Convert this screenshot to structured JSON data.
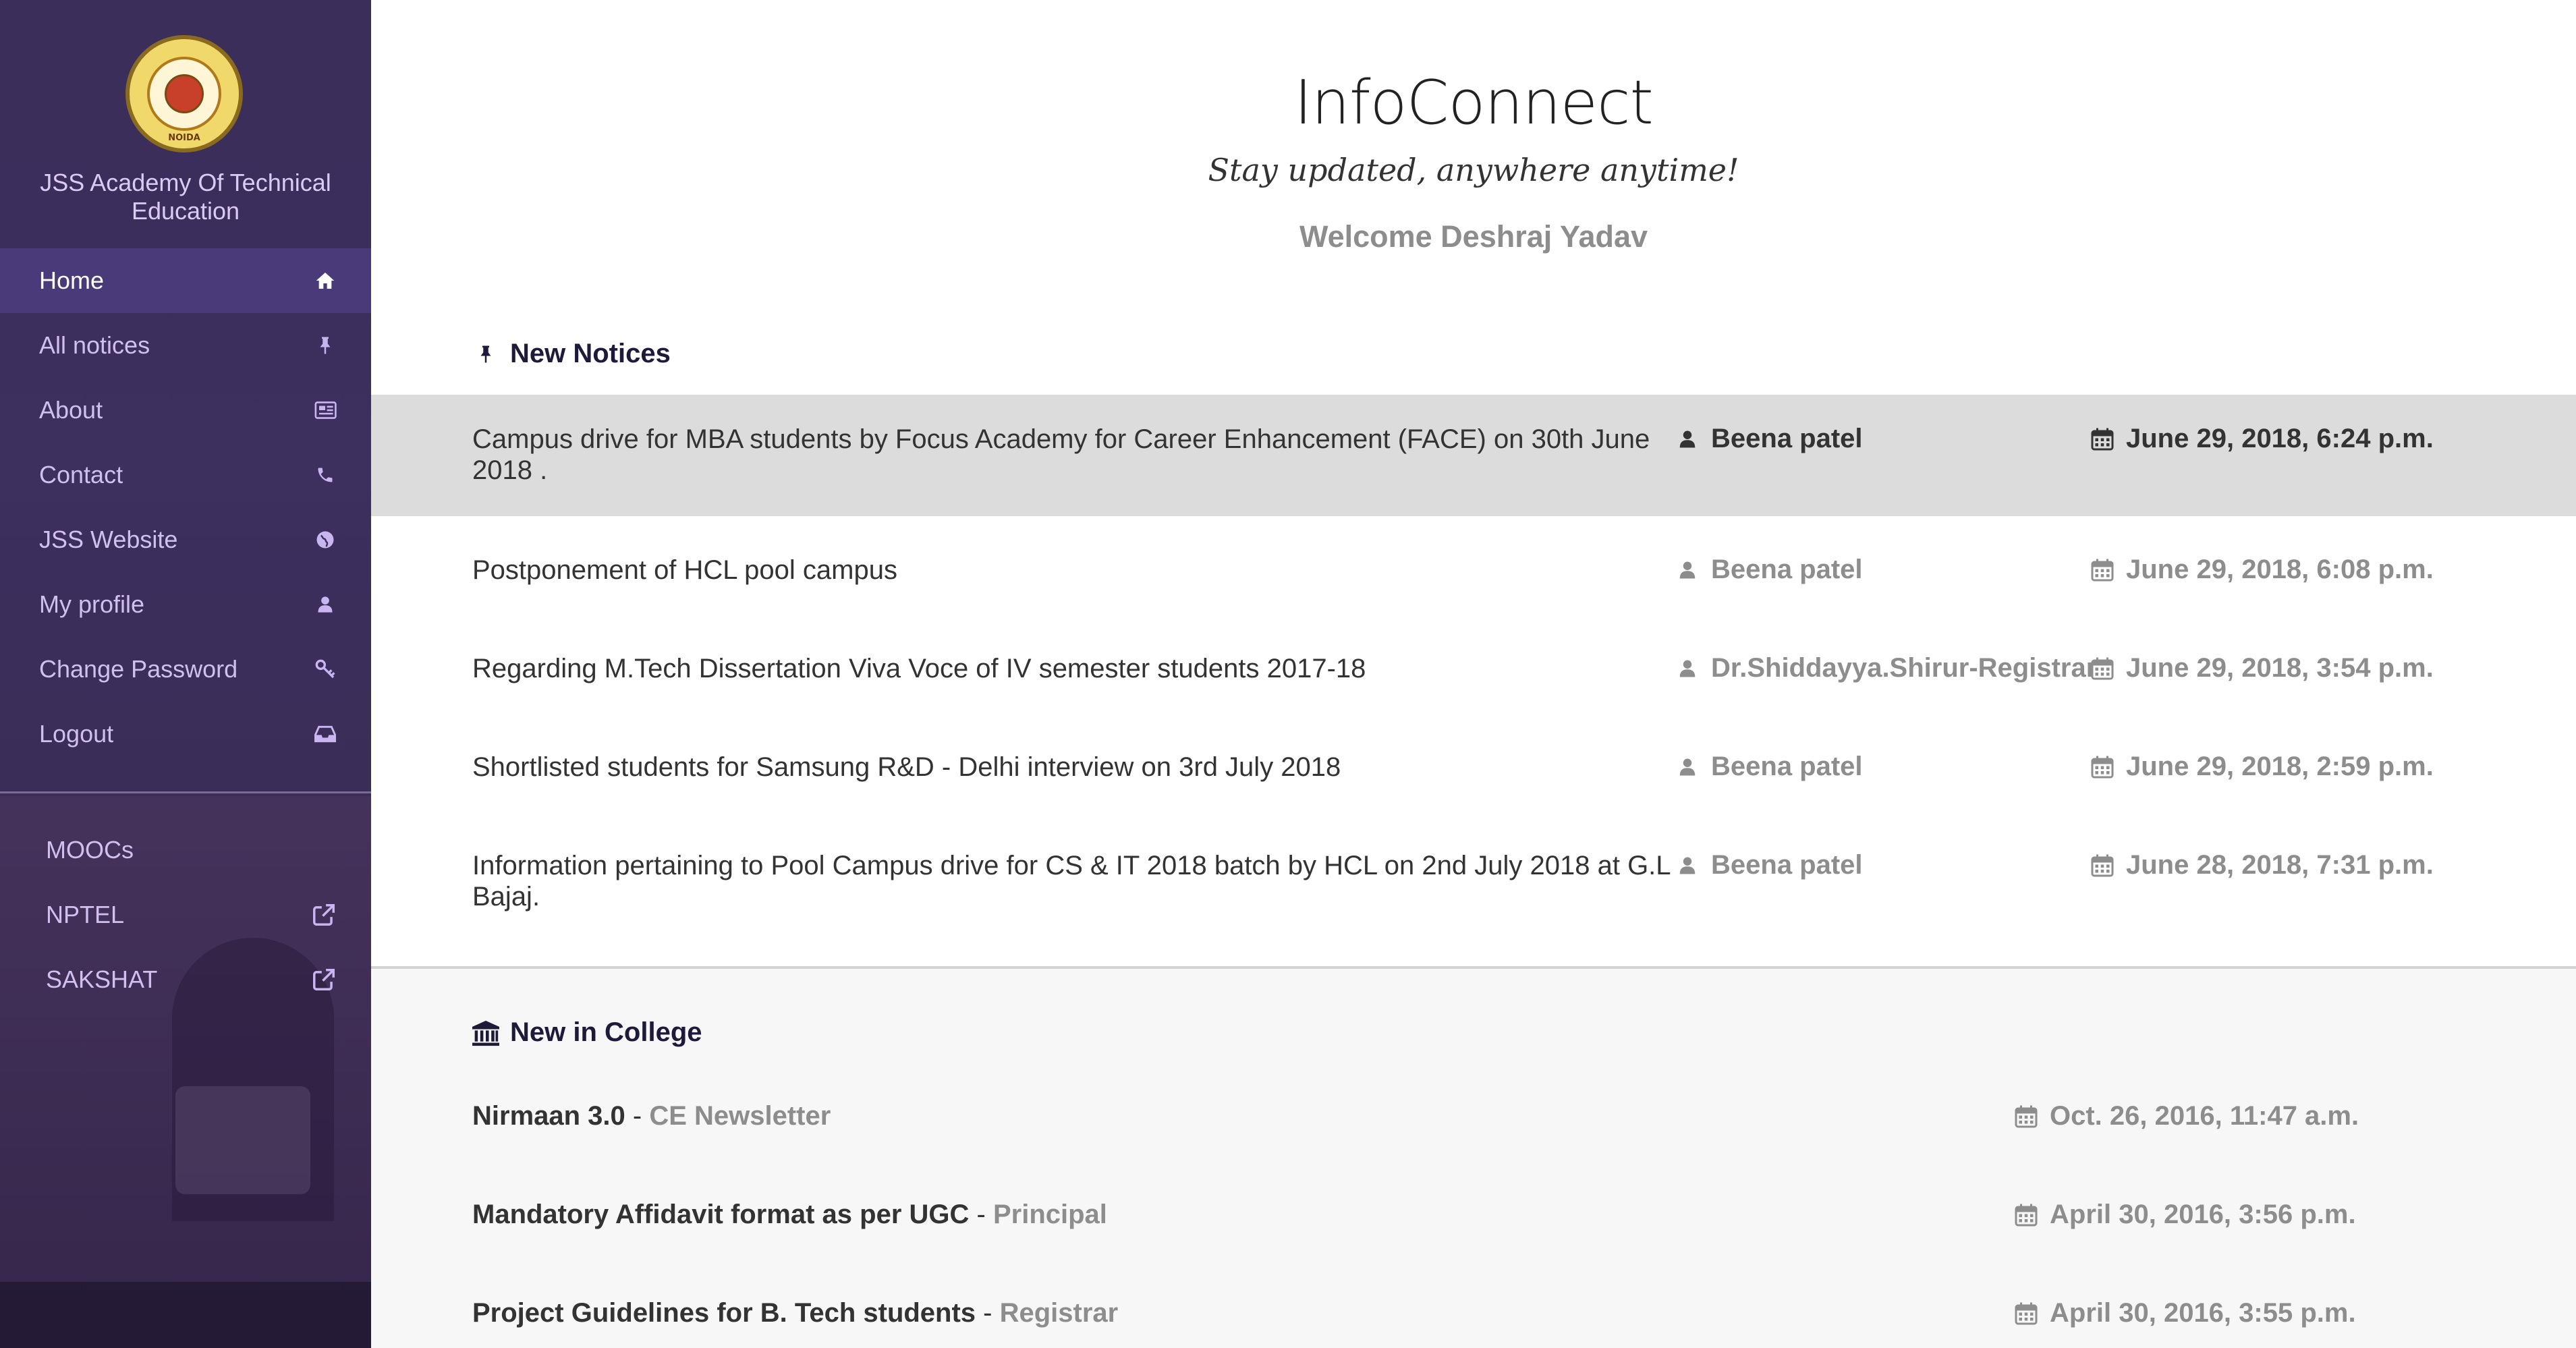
{
  "sidebar": {
    "logo_text": "NOIDA",
    "org_name": "JSS Academy Of Technical Education",
    "nav": [
      {
        "label": "Home",
        "icon": "home-icon",
        "active": true
      },
      {
        "label": "All notices",
        "icon": "pushpin-icon"
      },
      {
        "label": "About",
        "icon": "newspaper-icon"
      },
      {
        "label": "Contact",
        "icon": "phone-icon"
      },
      {
        "label": "JSS Website",
        "icon": "globe-icon"
      },
      {
        "label": "My profile",
        "icon": "user-icon"
      },
      {
        "label": "Change Password",
        "icon": "key-icon"
      },
      {
        "label": "Logout",
        "icon": "inbox-icon"
      }
    ],
    "external": [
      {
        "label": "MOOCs",
        "icon": ""
      },
      {
        "label": "NPTEL",
        "icon": "external-link-icon"
      },
      {
        "label": "SAKSHAT",
        "icon": "external-link-icon"
      }
    ]
  },
  "header": {
    "title": "InfoConnect",
    "tagline": "Stay updated, anywhere anytime!",
    "welcome": "Welcome Deshraj Yadav"
  },
  "new_notices": {
    "heading": "New Notices",
    "items": [
      {
        "title": "Campus drive for MBA students by Focus Academy for Career Enhancement (FACE) on 30th June 2018 .",
        "author": "Beena patel",
        "date": "June 29, 2018, 6:24 p.m.",
        "highlighted": true
      },
      {
        "title": "Postponement of HCL pool campus",
        "author": "Beena patel",
        "date": "June 29, 2018, 6:08 p.m."
      },
      {
        "title": "Regarding M.Tech Dissertation Viva Voce of IV semester students 2017-18",
        "author": "Dr.Shiddayya.Shirur-Registrar",
        "date": "June 29, 2018, 3:54 p.m."
      },
      {
        "title": "Shortlisted students for Samsung R&D - Delhi interview on 3rd July 2018",
        "author": "Beena patel",
        "date": "June 29, 2018, 2:59 p.m."
      },
      {
        "title": "Information pertaining to Pool Campus drive for CS & IT 2018 batch by HCL on 2nd July 2018 at G.L Bajaj.",
        "author": "Beena patel",
        "date": "June 28, 2018, 7:31 p.m."
      }
    ]
  },
  "new_in_college": {
    "heading": "New in College",
    "separator": " - ",
    "items": [
      {
        "title": "Nirmaan 3.0",
        "category": "CE Newsletter",
        "date": "Oct. 26, 2016, 11:47 a.m."
      },
      {
        "title": "Mandatory Affidavit format as per UGC",
        "category": "Principal",
        "date": "April 30, 2016, 3:56 p.m."
      },
      {
        "title": "Project Guidelines for B. Tech students",
        "category": "Registrar",
        "date": "April 30, 2016, 3:55 p.m."
      }
    ]
  },
  "colors": {
    "sidebar_bg": "#3b2e5a",
    "sidebar_active": "#4b3a7a",
    "sidebar_text": "#cfc0f0",
    "highlight_row": "#dcdcdc",
    "muted_text": "#8d8d8d"
  }
}
